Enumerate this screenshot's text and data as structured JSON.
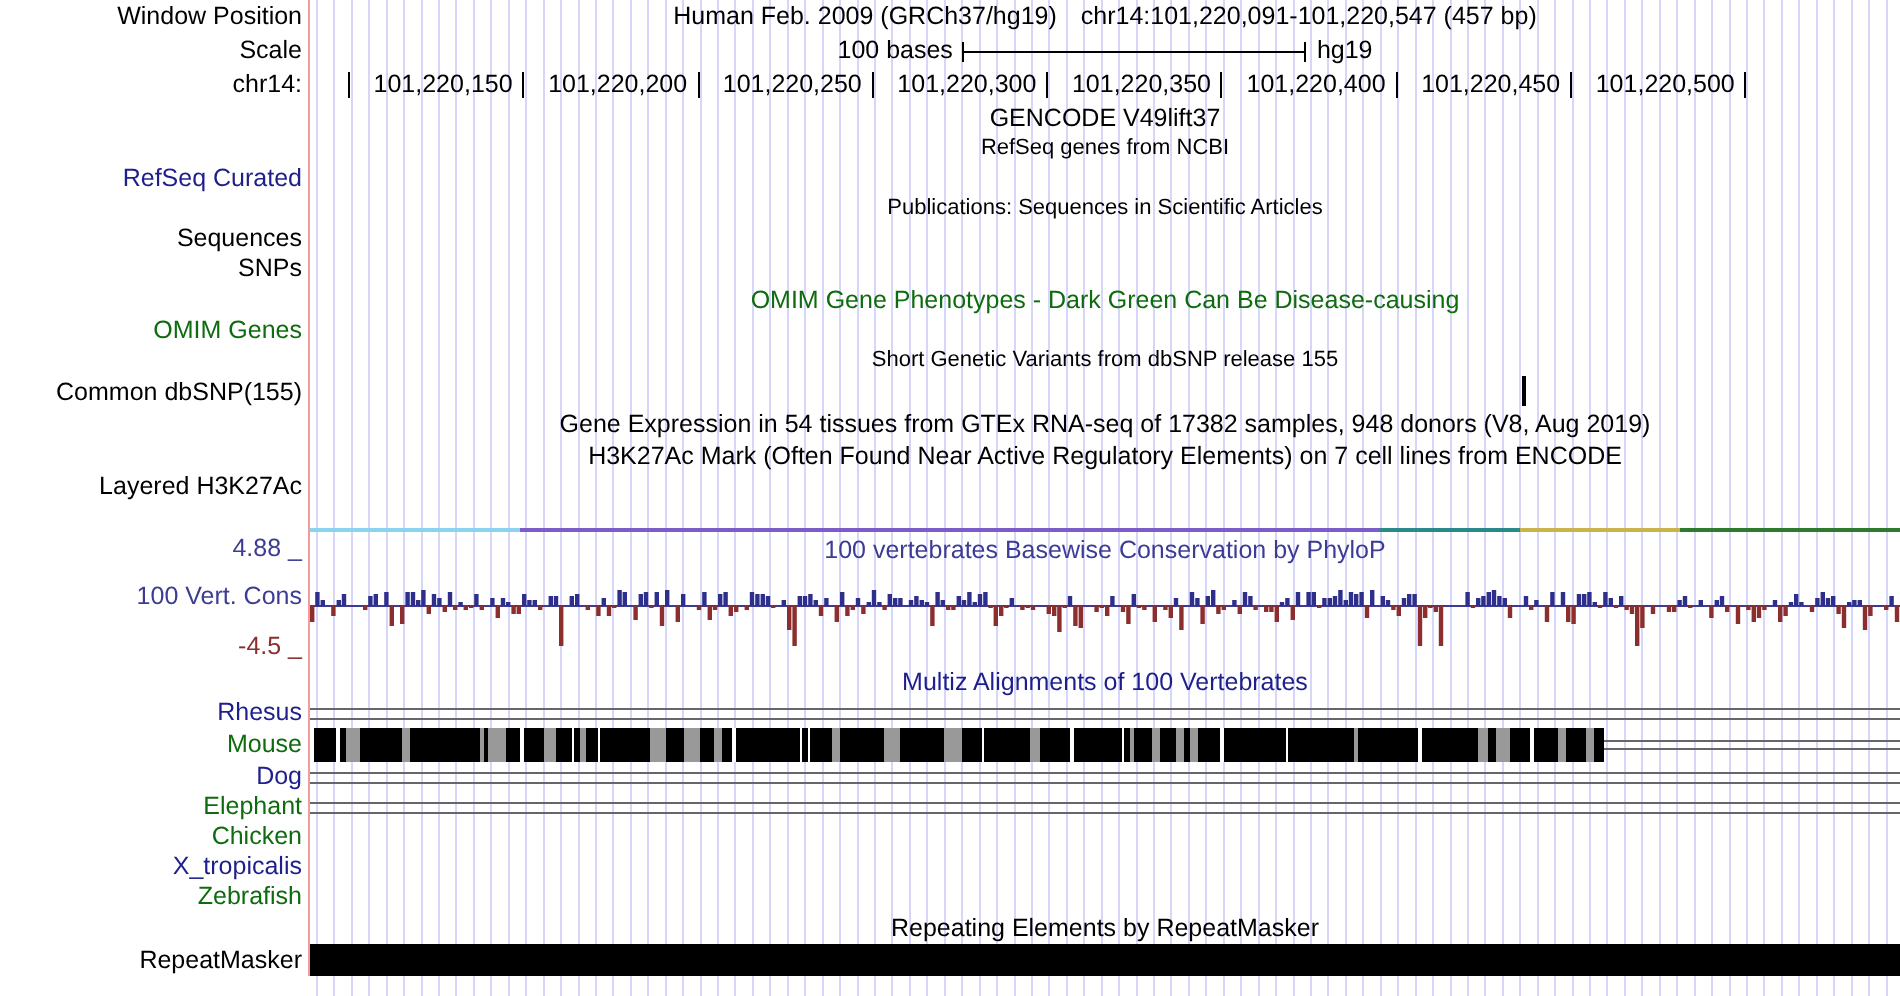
{
  "position": {
    "label": "Window Position",
    "assembly": "Human Feb. 2009 (GRCh37/hg19)",
    "range": "chr14:101,220,091-101,220,547 (457 bp)"
  },
  "scale": {
    "label": "Scale",
    "length": "100 bases",
    "assembly": "hg19"
  },
  "ruler": {
    "label": "chr14:",
    "ticks": [
      "101,220,150",
      "101,220,200",
      "101,220,250",
      "101,220,300",
      "101,220,350",
      "101,220,400",
      "101,220,450",
      "101,220,500"
    ]
  },
  "tracks": [
    {
      "kind": "title",
      "text": "GENCODE V49lift37",
      "color": "#000000"
    },
    {
      "kind": "subtitle",
      "text": "RefSeq genes from NCBI"
    },
    {
      "kind": "label",
      "label": "RefSeq Curated",
      "color": "#1e1e8c"
    },
    {
      "kind": "subtitle",
      "text": "Publications: Sequences in Scientific Articles"
    },
    {
      "kind": "label",
      "label": "Sequences",
      "color": "#000000"
    },
    {
      "kind": "label",
      "label": "SNPs",
      "color": "#000000"
    },
    {
      "kind": "title",
      "text": "OMIM Gene Phenotypes - Dark Green Can Be Disease-causing",
      "color": "#0e6b0e"
    },
    {
      "kind": "label",
      "label": "OMIM Genes",
      "color": "#0e6b0e"
    },
    {
      "kind": "subtitle",
      "text": "Short Genetic Variants from dbSNP release 155"
    },
    {
      "kind": "snp",
      "label": "Common dbSNP(155)",
      "color": "#000000"
    },
    {
      "kind": "title",
      "text": "Gene Expression in 54 tissues from GTEx RNA-seq of 17382 samples, 948 donors (V8, Aug 2019)",
      "color": "#000000"
    },
    {
      "kind": "title",
      "text": "H3K27Ac Mark (Often Found Near Active Regulatory Elements) on 7 cell lines from ENCODE",
      "color": "#000000"
    },
    {
      "kind": "layered",
      "label": "Layered H3K27Ac",
      "color": "#000000"
    },
    {
      "kind": "wiggle",
      "max": "4.88 _",
      "label": "100 Vert. Cons",
      "min": "-4.5 _",
      "title": "100 vertebrates Basewise Conservation by PhyloP",
      "color": "#3c3c94"
    },
    {
      "kind": "title",
      "text": "Multiz Alignments of 100 Vertebrates",
      "color": "#1e1e8c"
    },
    {
      "kind": "lines",
      "label": "Rhesus",
      "color": "#1e1e8c"
    },
    {
      "kind": "blocks",
      "label": "Mouse",
      "color": "#0e6b0e"
    },
    {
      "kind": "lines",
      "label": "Dog",
      "color": "#1e1e8c"
    },
    {
      "kind": "lines",
      "label": "Elephant",
      "color": "#0e6b0e"
    },
    {
      "kind": "species",
      "label": "Chicken",
      "color": "#0e6b0e"
    },
    {
      "kind": "species",
      "label": "X_tropicalis",
      "color": "#1e1e8c"
    },
    {
      "kind": "species",
      "label": "Zebrafish",
      "color": "#0e6b0e"
    },
    {
      "kind": "title",
      "text": "Repeating Elements by RepeatMasker",
      "color": "#000000"
    },
    {
      "kind": "bar",
      "label": "RepeatMasker",
      "color": "#000000"
    }
  ]
}
